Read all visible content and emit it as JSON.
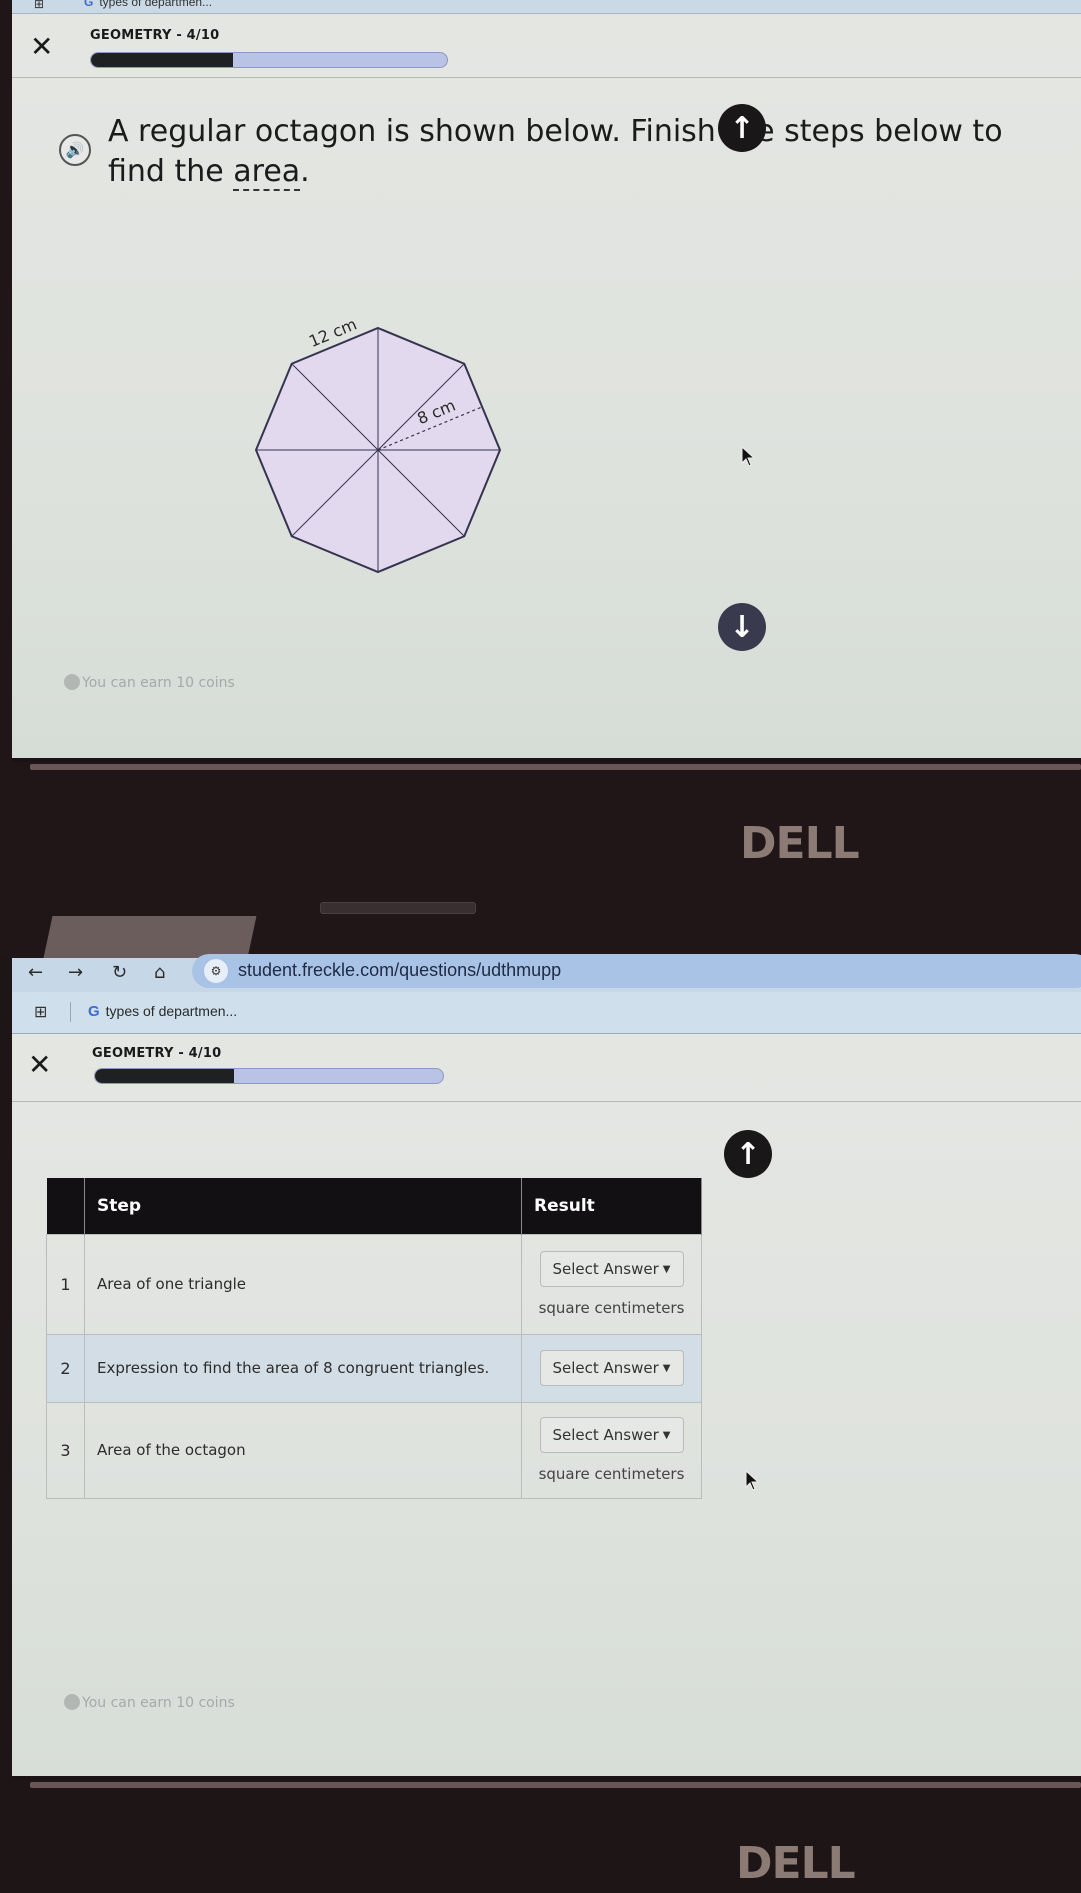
{
  "browser": {
    "url": "student.freckle.com/questions/udthmupp",
    "bookmark_tab": "types of departmen...",
    "bookmark_tab_top_partial": "types of departmen..."
  },
  "header": {
    "title": "GEOMETRY - 4/10",
    "progress_fraction": 0.4
  },
  "question": {
    "text_before": "A regular octagon is shown below. Finish the steps below to find the ",
    "vocab_word": "area",
    "text_after": "."
  },
  "figure": {
    "shape": "regular octagon",
    "side_label": "12 cm",
    "apothem_label": "8 cm",
    "fill_color": "#e3d9ee",
    "stroke_color": "#35334f"
  },
  "coins_text": "You can earn 10 coins",
  "table": {
    "headers": [
      "",
      "Step",
      "Result"
    ],
    "rows": [
      {
        "num": "1",
        "step": "Area of one triangle",
        "select_label": "Select Answer",
        "unit": "square centimeters"
      },
      {
        "num": "2",
        "step": "Expression to find the area of 8 congruent triangles.",
        "select_label": "Select Answer",
        "unit": ""
      },
      {
        "num": "3",
        "step": "Area of the octagon",
        "select_label": "Select Answer",
        "unit": "square centimeters"
      }
    ]
  },
  "icons": {
    "close": "✕",
    "speaker": "🔊",
    "scroll_up": "↑",
    "scroll_down": "↓",
    "back": "←",
    "forward": "→",
    "reload": "↻",
    "home": "⌂",
    "apps": "⊞",
    "site_settings": "⚙"
  },
  "brand": "DELL",
  "colors": {
    "progress_fill": "#1f2022",
    "progress_track": "#b8c3e6",
    "table_header": "#121012",
    "row_highlight": "#d2dde6",
    "scroll_button": "#3a3a4e"
  }
}
